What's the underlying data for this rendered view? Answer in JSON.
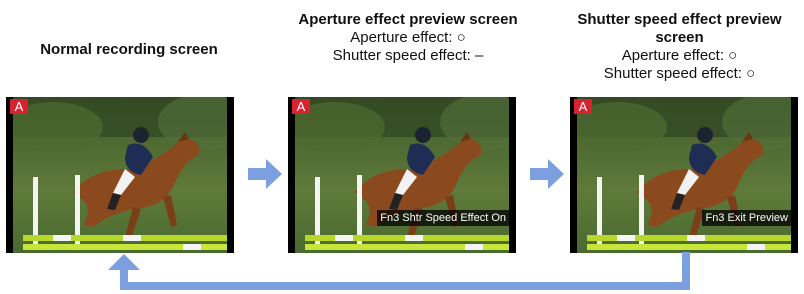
{
  "screens": [
    {
      "title": "Normal recording screen",
      "lines": [],
      "mode_badge": "A",
      "overlay": ""
    },
    {
      "title": "Aperture effect preview screen",
      "lines": [
        "Aperture effect: ○",
        "Shutter speed effect: –"
      ],
      "mode_badge": "A",
      "overlay": "Fn3 Shtr Speed Effect On"
    },
    {
      "title": "Shutter speed effect preview screen",
      "lines": [
        "Aperture effect: ○",
        "Shutter speed effect: ○"
      ],
      "mode_badge": "A",
      "overlay": "Fn3 Exit Preview"
    }
  ],
  "colors": {
    "arrow": "#7c9fe0",
    "badge": "#d7232f"
  },
  "icons": {
    "forward_arrow": "right-arrow-icon",
    "return_arrow": "return-arrow-icon"
  }
}
